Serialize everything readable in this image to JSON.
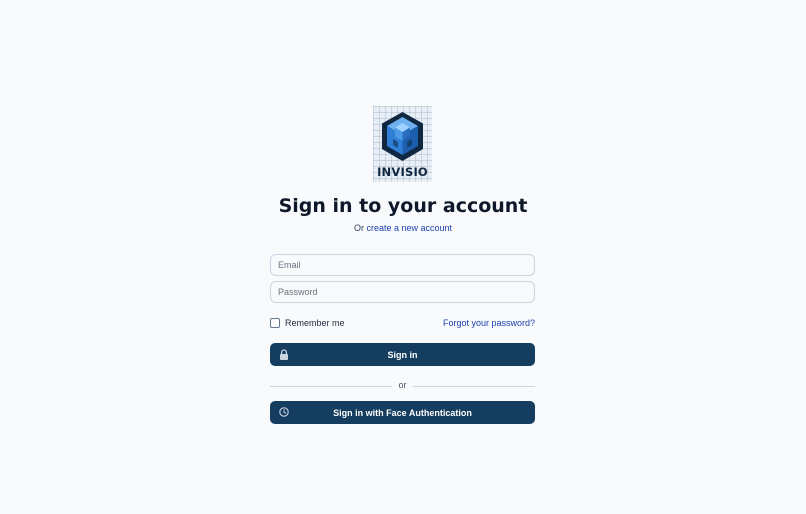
{
  "brand": {
    "name": "INVISIO"
  },
  "header": {
    "title": "Sign in to your account",
    "subtitle_prefix": "Or",
    "create_account_link": "create a new account"
  },
  "form": {
    "email_placeholder": "Email",
    "password_placeholder": "Password",
    "remember_label": "Remember me",
    "forgot_link": "Forgot your password?",
    "signin_label": "Sign in",
    "divider_text": "or",
    "face_auth_label": "Sign in with Face Authentication"
  },
  "icons": {
    "logo": "hexagon-cube-logo",
    "signin": "lock-icon",
    "face_auth": "face-scan-icon"
  },
  "colors": {
    "background": "#f8fafc",
    "primary_button": "#143d5f",
    "link": "#1e40af",
    "logo_blue": "#2f7fd8",
    "logo_dark": "#0f2741"
  }
}
